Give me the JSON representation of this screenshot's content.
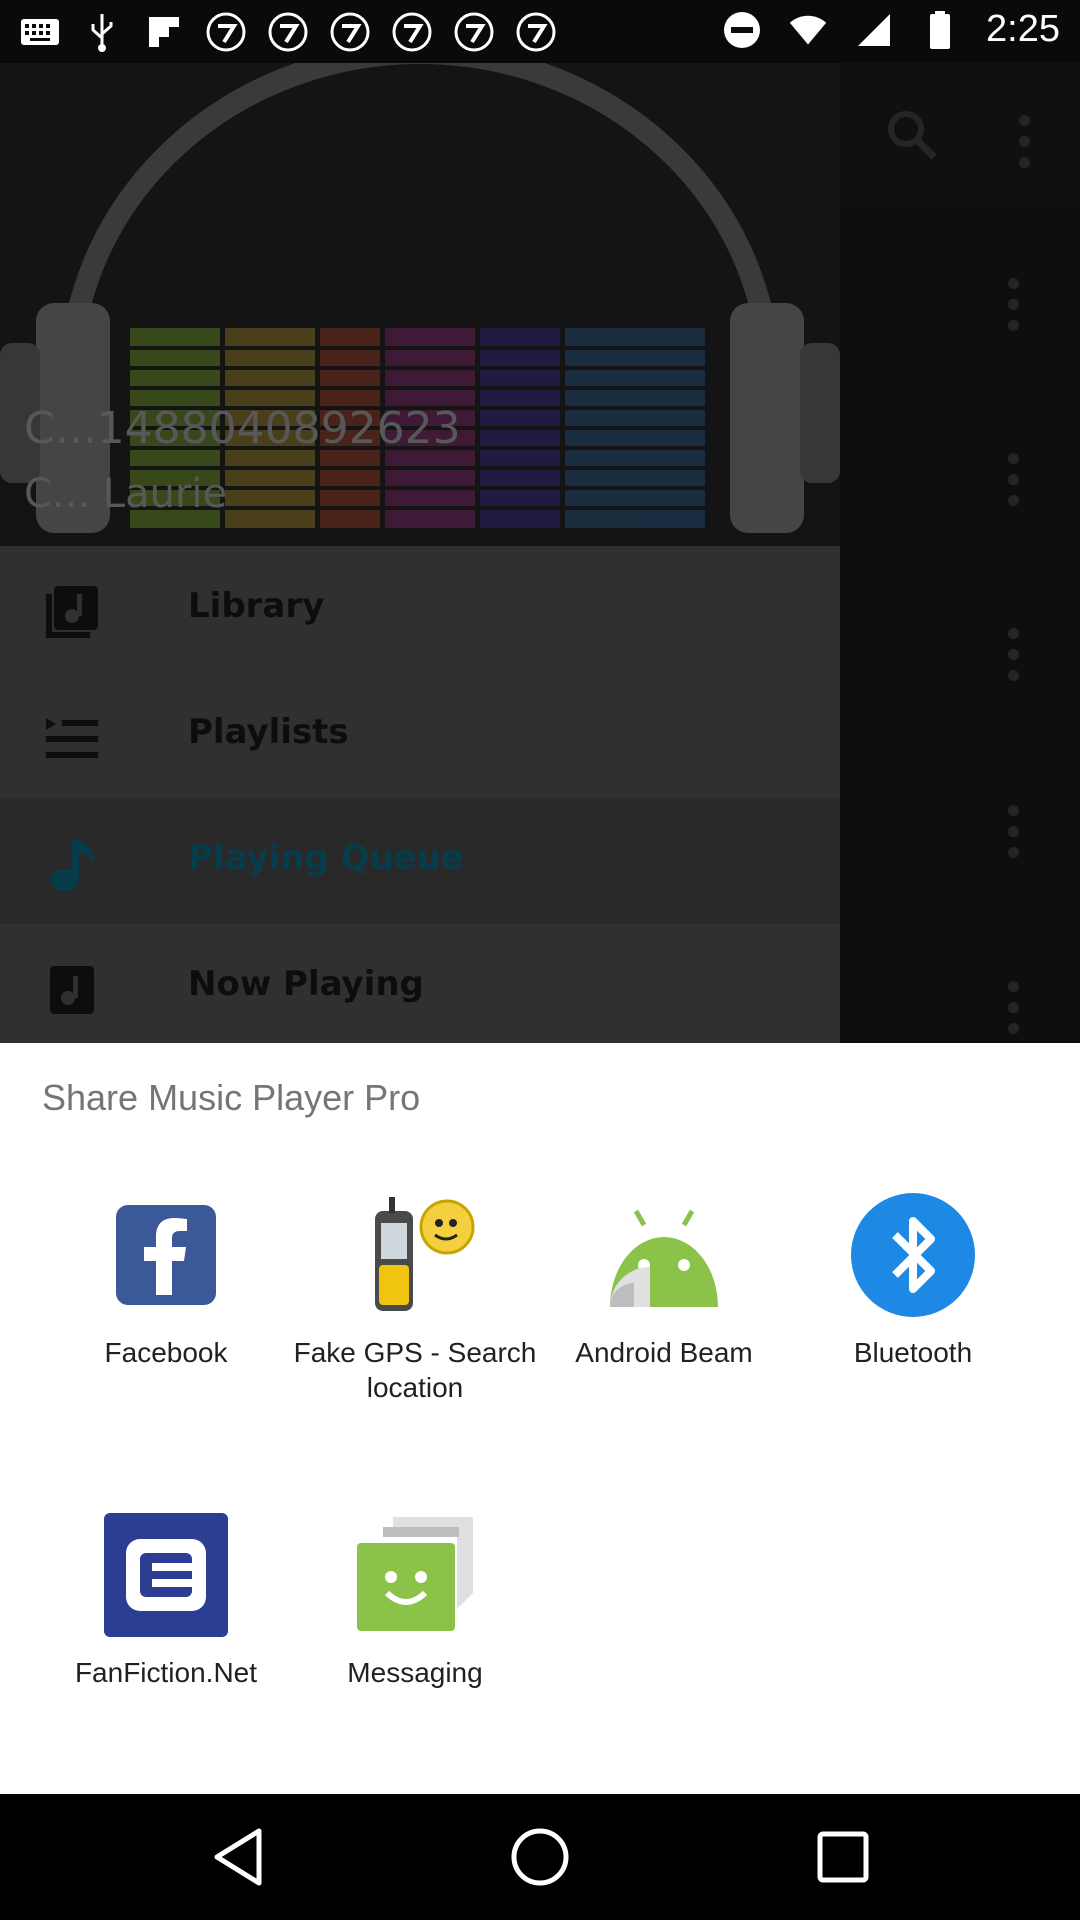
{
  "status_bar": {
    "time": "2:25",
    "left_icons": [
      "keyboard-icon",
      "usb-icon",
      "flipboard-icon",
      "abc7-icon",
      "abc7-icon",
      "abc7-icon",
      "abc7-icon",
      "abc7-icon",
      "abc7-icon"
    ],
    "right_icons": [
      "do-not-disturb-icon",
      "wifi-icon",
      "signal-icon",
      "battery-icon"
    ]
  },
  "drawer": {
    "header_line1": "C...1488040892623",
    "header_line2": "C... Laurie",
    "items": [
      {
        "label": "Library",
        "icon": "library-music-icon"
      },
      {
        "label": "Playlists",
        "icon": "playlist-icon"
      },
      {
        "label": "Playing Queue",
        "icon": "music-note-icon"
      },
      {
        "label": "Now Playing",
        "icon": "now-playing-icon"
      }
    ]
  },
  "share_sheet": {
    "title": "Share Music Player Pro",
    "apps": [
      {
        "label": "Facebook",
        "icon": "facebook-icon"
      },
      {
        "label": "Fake GPS - Search location",
        "icon": "fake-gps-icon"
      },
      {
        "label": "Android Beam",
        "icon": "android-beam-icon"
      },
      {
        "label": "Bluetooth",
        "icon": "bluetooth-icon"
      },
      {
        "label": "FanFiction.Net",
        "icon": "fanfiction-icon"
      },
      {
        "label": "Messaging",
        "icon": "messaging-icon"
      }
    ]
  },
  "colors": {
    "facebook": "#3b5998",
    "bluetooth": "#1e88e5",
    "android": "#8bc34a",
    "fanfiction": "#2c3e94",
    "messaging": "#8bc34a",
    "active_item": "#0b5d73"
  }
}
